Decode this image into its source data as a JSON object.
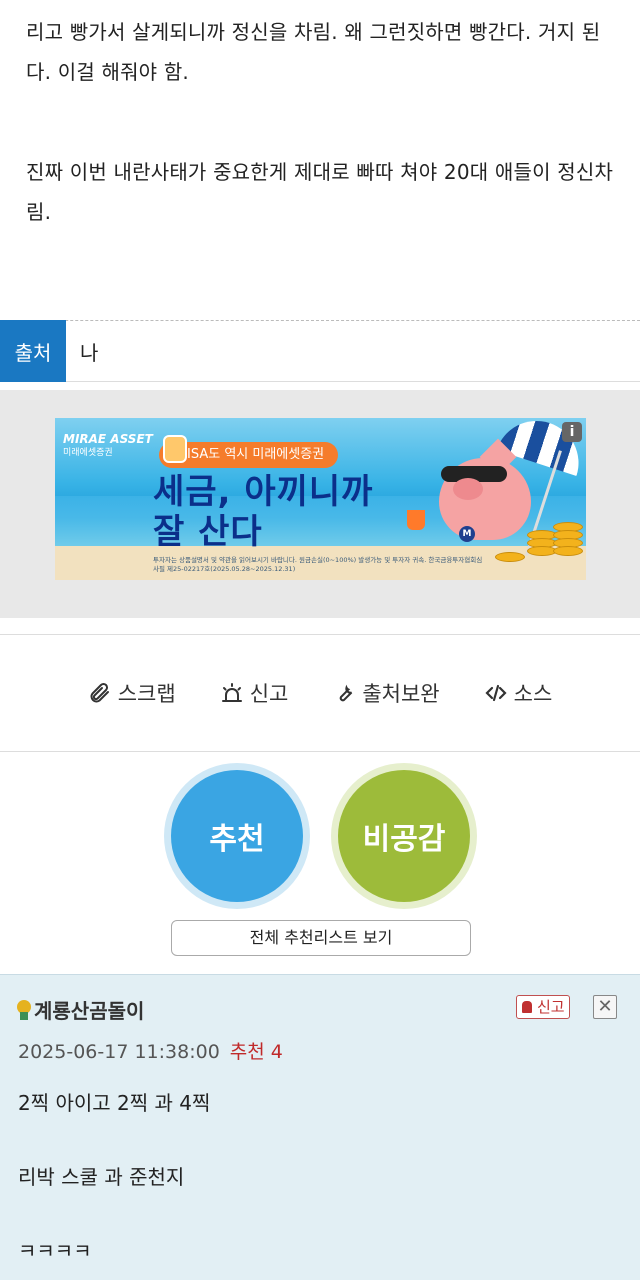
{
  "article": {
    "paragraph1": "리고 빵가서 살게되니까 정신을 차림. 왜 그런짓하면 빵간다. 거지 된다. 이걸 해줘야 함.",
    "paragraph2": "진짜 이번 내란사태가 중요한게 제대로 빠따 쳐야 20대 애들이 정신차림."
  },
  "source": {
    "label": "출처",
    "value": "나"
  },
  "ad": {
    "logo_en": "MIRAE ASSET",
    "logo_ko": "미래에셋증권",
    "pill": "ISA도 역시 미래에셋증권",
    "headline_line1": "세금, 아끼니까",
    "headline_line2": "잘 산다",
    "info_icon": "i",
    "badge": "M",
    "fine_print": "투자자는 상품설명서 및 약관을 읽어보시기 바랍니다. 원금손실(0~100%) 발생가능 및 투자자 귀속. 한국금융투자협회심사필 제25-02217호(2025.05.28~2025.12.31)"
  },
  "actions": [
    {
      "label": "스크랩",
      "icon": "paperclip-icon"
    },
    {
      "label": "신고",
      "icon": "siren-icon"
    },
    {
      "label": "출처보완",
      "icon": "wrench-icon"
    },
    {
      "label": "소스",
      "icon": "code-icon"
    }
  ],
  "votes": {
    "up_label": "추천",
    "down_label": "비공감",
    "list_label": "전체 추천리스트 보기"
  },
  "comment": {
    "author": "계룡산곰돌이",
    "report_label": "신고",
    "close_label": "✕",
    "timestamp": "2025-06-17 11:38:00",
    "recommend": "추천 4",
    "lines": [
      "2찍 아이고 2찍 과 4찍",
      "리박 스쿨 과 준천지",
      "ㅋㅋㅋㅋ"
    ]
  },
  "colors": {
    "source_tag": "#1a78c2",
    "vote_up": "#3aa5e3",
    "vote_down": "#9dbb3a",
    "comment_bg": "#e2eff4",
    "recommend_text": "#c02a2a"
  }
}
